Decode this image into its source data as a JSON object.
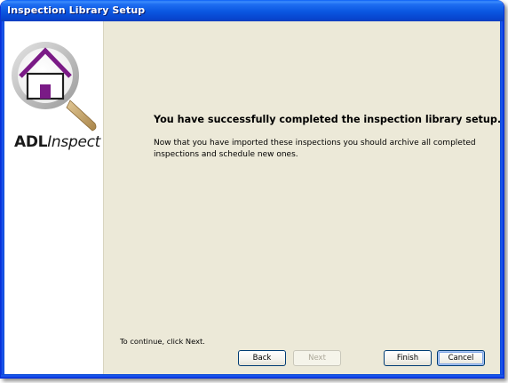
{
  "window": {
    "title": "Inspection Library Setup"
  },
  "sidebar": {
    "logo": {
      "brand_bold": "ADL",
      "brand_italic": "Inspect",
      "icon": "house-magnifier-icon"
    }
  },
  "main": {
    "heading": "You have successfully completed the inspection library setup.",
    "body": "Now that you have imported these inspections you should archive all completed inspections and schedule new ones.",
    "continue_hint": "To continue, click Next."
  },
  "buttons": {
    "back": "Back",
    "next": "Next",
    "finish": "Finish",
    "cancel": "Cancel"
  },
  "colors": {
    "titlebar": "#0a56e0",
    "dialog_bg": "#ece9d8",
    "logo_purple": "#7a1a86",
    "logo_ring": "#c8c8c8",
    "logo_handle": "#c8a870"
  }
}
